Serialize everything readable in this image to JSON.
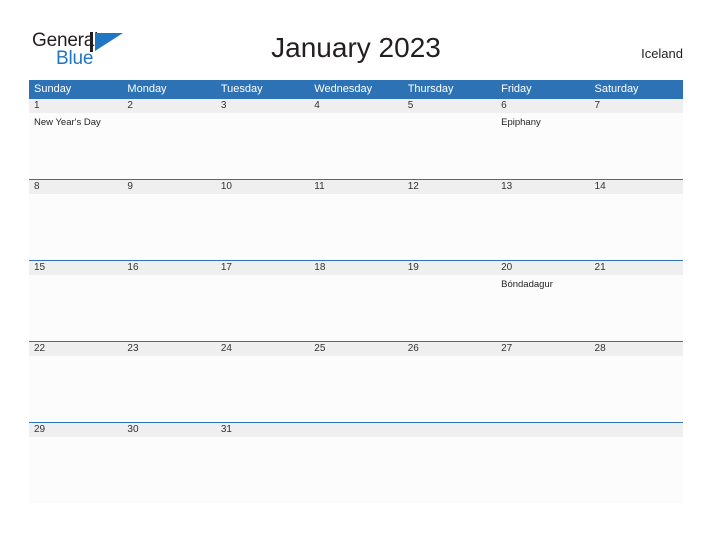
{
  "brand": {
    "name_part1": "General",
    "name_part2": "Blue",
    "flag_color": "#1f76c2",
    "text_color": "#231f20"
  },
  "header": {
    "title": "January 2023",
    "country": "Iceland"
  },
  "theme": {
    "header_bar_color": "#2d72b5",
    "date_band_color": "#efefef",
    "cell_background": "#fcfcfd",
    "row_divider_color": "#2d72b5",
    "weekday_text_color": "#ffffff"
  },
  "calendar": {
    "weekdays": [
      "Sunday",
      "Monday",
      "Tuesday",
      "Wednesday",
      "Thursday",
      "Friday",
      "Saturday"
    ],
    "weeks": [
      {
        "days": [
          {
            "date": "1",
            "event": "New Year's Day"
          },
          {
            "date": "2",
            "event": ""
          },
          {
            "date": "3",
            "event": ""
          },
          {
            "date": "4",
            "event": ""
          },
          {
            "date": "5",
            "event": ""
          },
          {
            "date": "6",
            "event": "Epiphany"
          },
          {
            "date": "7",
            "event": ""
          }
        ]
      },
      {
        "days": [
          {
            "date": "8",
            "event": ""
          },
          {
            "date": "9",
            "event": ""
          },
          {
            "date": "10",
            "event": ""
          },
          {
            "date": "11",
            "event": ""
          },
          {
            "date": "12",
            "event": ""
          },
          {
            "date": "13",
            "event": ""
          },
          {
            "date": "14",
            "event": ""
          }
        ]
      },
      {
        "days": [
          {
            "date": "15",
            "event": ""
          },
          {
            "date": "16",
            "event": ""
          },
          {
            "date": "17",
            "event": ""
          },
          {
            "date": "18",
            "event": ""
          },
          {
            "date": "19",
            "event": ""
          },
          {
            "date": "20",
            "event": "Bóndadagur"
          },
          {
            "date": "21",
            "event": ""
          }
        ]
      },
      {
        "days": [
          {
            "date": "22",
            "event": ""
          },
          {
            "date": "23",
            "event": ""
          },
          {
            "date": "24",
            "event": ""
          },
          {
            "date": "25",
            "event": ""
          },
          {
            "date": "26",
            "event": ""
          },
          {
            "date": "27",
            "event": ""
          },
          {
            "date": "28",
            "event": ""
          }
        ]
      },
      {
        "days": [
          {
            "date": "29",
            "event": ""
          },
          {
            "date": "30",
            "event": ""
          },
          {
            "date": "31",
            "event": ""
          },
          {
            "date": "",
            "event": ""
          },
          {
            "date": "",
            "event": ""
          },
          {
            "date": "",
            "event": ""
          },
          {
            "date": "",
            "event": ""
          }
        ]
      }
    ]
  }
}
